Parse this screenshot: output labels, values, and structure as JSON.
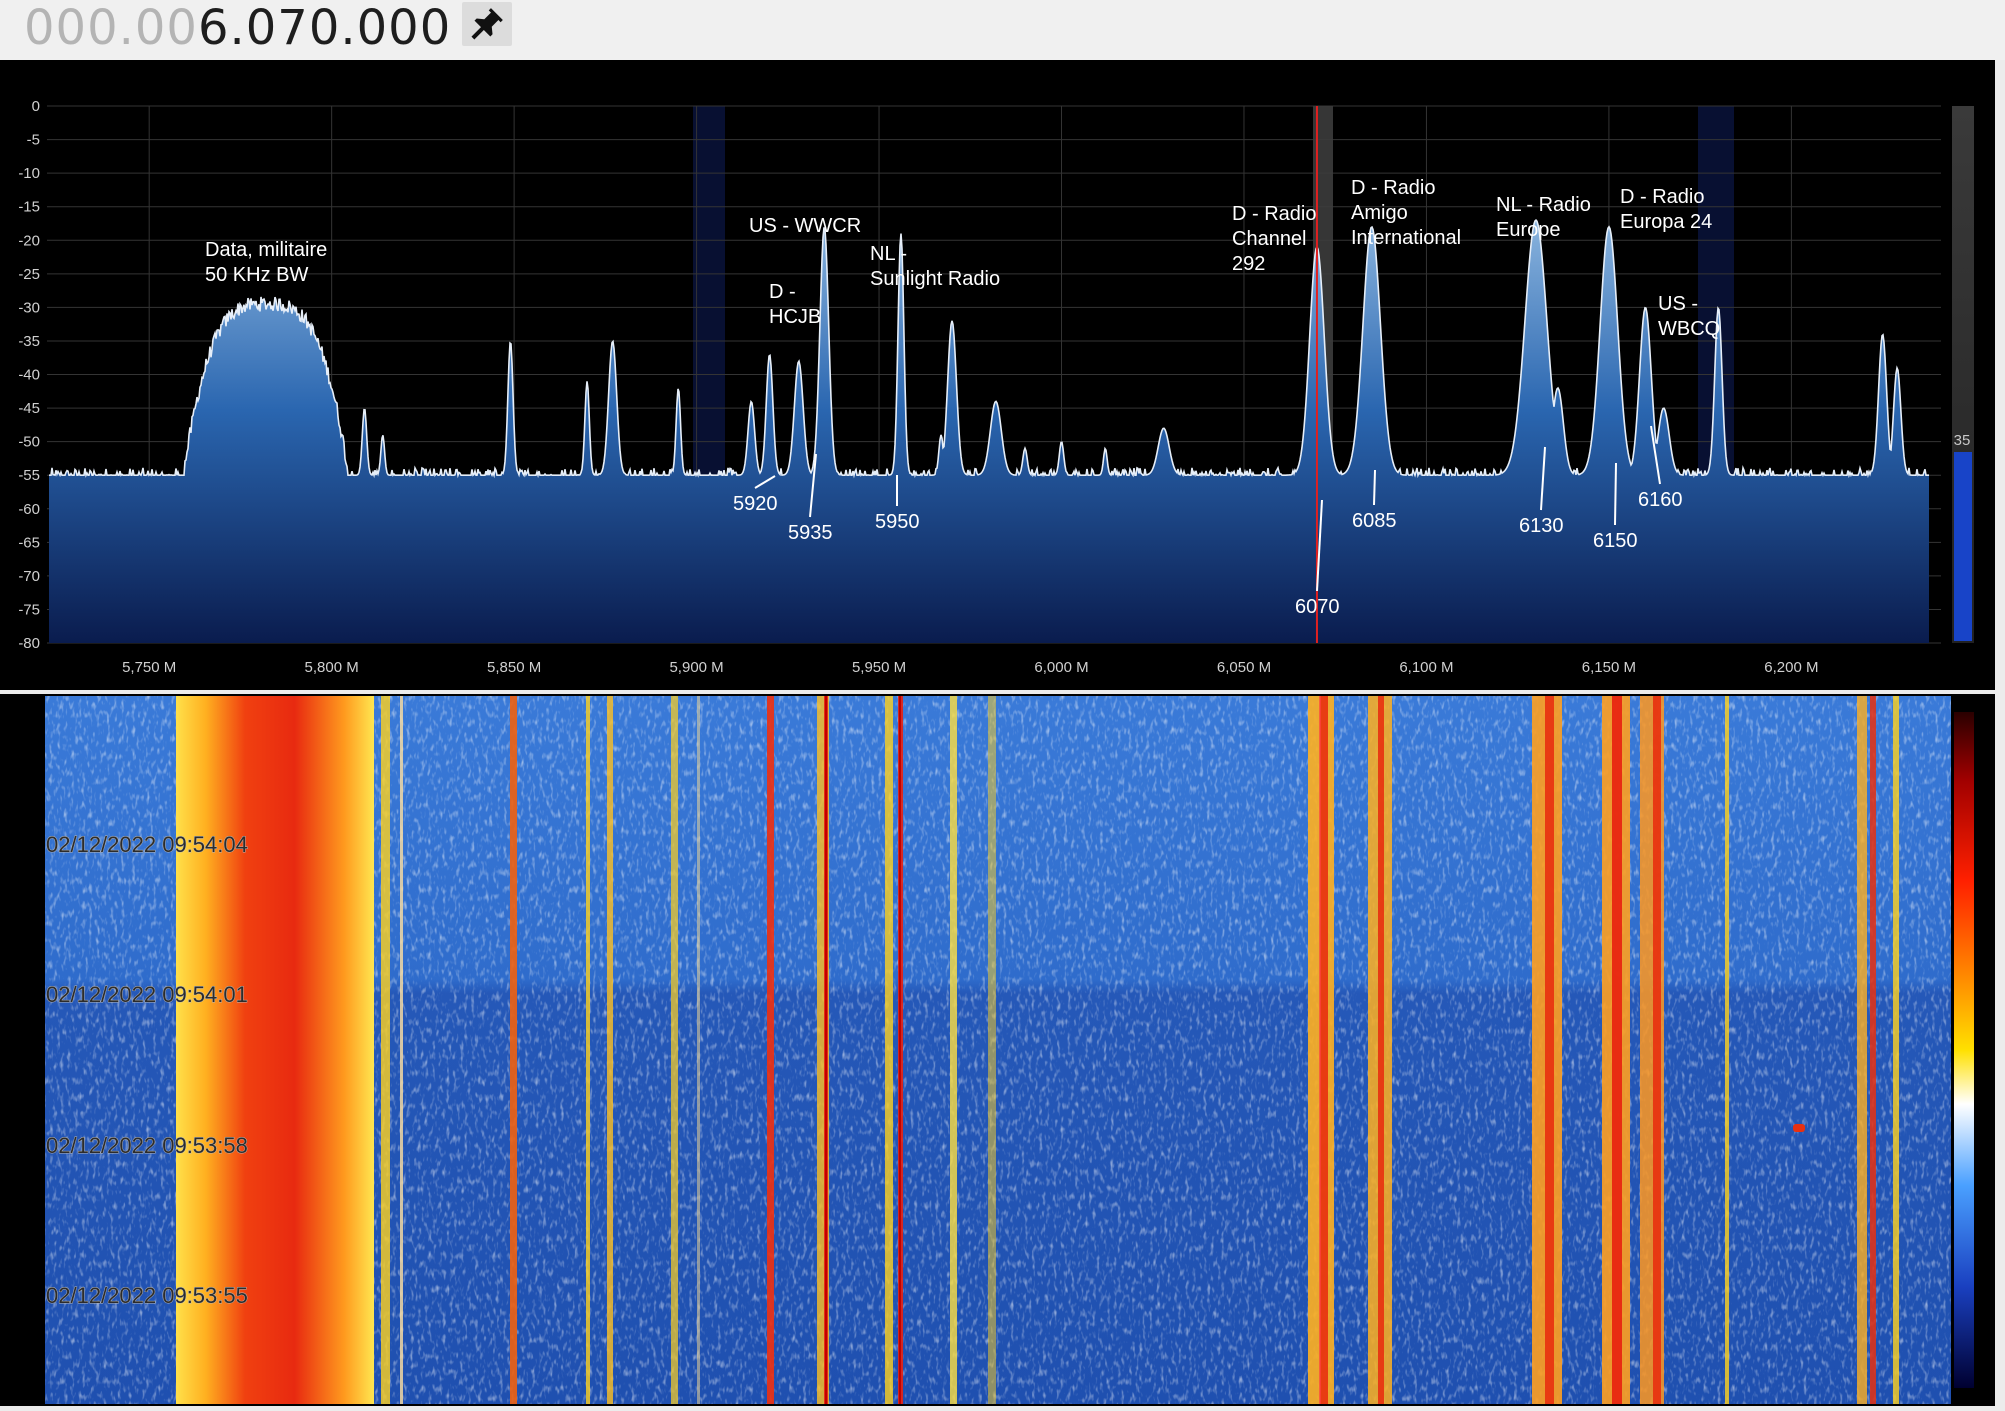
{
  "frequency": {
    "dim_digits": "000.00",
    "bright_digits": "6.070.000"
  },
  "pin_icon": "pin-icon",
  "spectrum": {
    "db_ticks": [
      "0",
      "-5",
      "-10",
      "-15",
      "-20",
      "-25",
      "-30",
      "-35",
      "-40",
      "-45",
      "-50",
      "-55",
      "-60",
      "-65",
      "-70",
      "-75",
      "-80"
    ],
    "freq_ticks": [
      "5,750 M",
      "5,800 M",
      "5,850 M",
      "5,900 M",
      "5,950 M",
      "6,000 M",
      "6,050 M",
      "6,100 M",
      "6,150 M",
      "6,200 M"
    ],
    "tuned_frequency_khz": 6070,
    "level_meter_value": "35",
    "colors": {
      "trace": "#e6eef8",
      "fill_top": "#6d9fd2",
      "fill_bottom": "#0a1c4e",
      "tuned_line": "#e02020",
      "grid": "#3a3a3a"
    }
  },
  "annotations": [
    {
      "lines": [
        "Data, militaire",
        "50 KHz BW"
      ]
    },
    {
      "lines": [
        "US - WWCR"
      ]
    },
    {
      "lines": [
        "D -",
        "HCJB"
      ]
    },
    {
      "lines": [
        "NL -",
        "Sunlight Radio"
      ]
    },
    {
      "lines": [
        "D  - Radio",
        "Channel",
        "292"
      ]
    },
    {
      "lines": [
        "D - Radio",
        "Amigo",
        "International"
      ]
    },
    {
      "lines": [
        "NL - Radio",
        "Europe"
      ]
    },
    {
      "lines": [
        "D - Radio",
        "Europa 24"
      ]
    },
    {
      "lines": [
        "US -",
        "WBCQ"
      ]
    }
  ],
  "freq_labels": [
    "5920",
    "5935",
    "5950",
    "6070",
    "6085",
    "6130",
    "6150",
    "6160"
  ],
  "waterfall": {
    "timestamps": [
      "02/12/2022 09:54:04",
      "02/12/2022 09:54:01",
      "02/12/2022 09:53:58",
      "02/12/2022 09:53:55"
    ],
    "colors": {
      "background": "#2a64c8",
      "hot": "#e83010",
      "warm": "#ffd21e"
    }
  }
}
